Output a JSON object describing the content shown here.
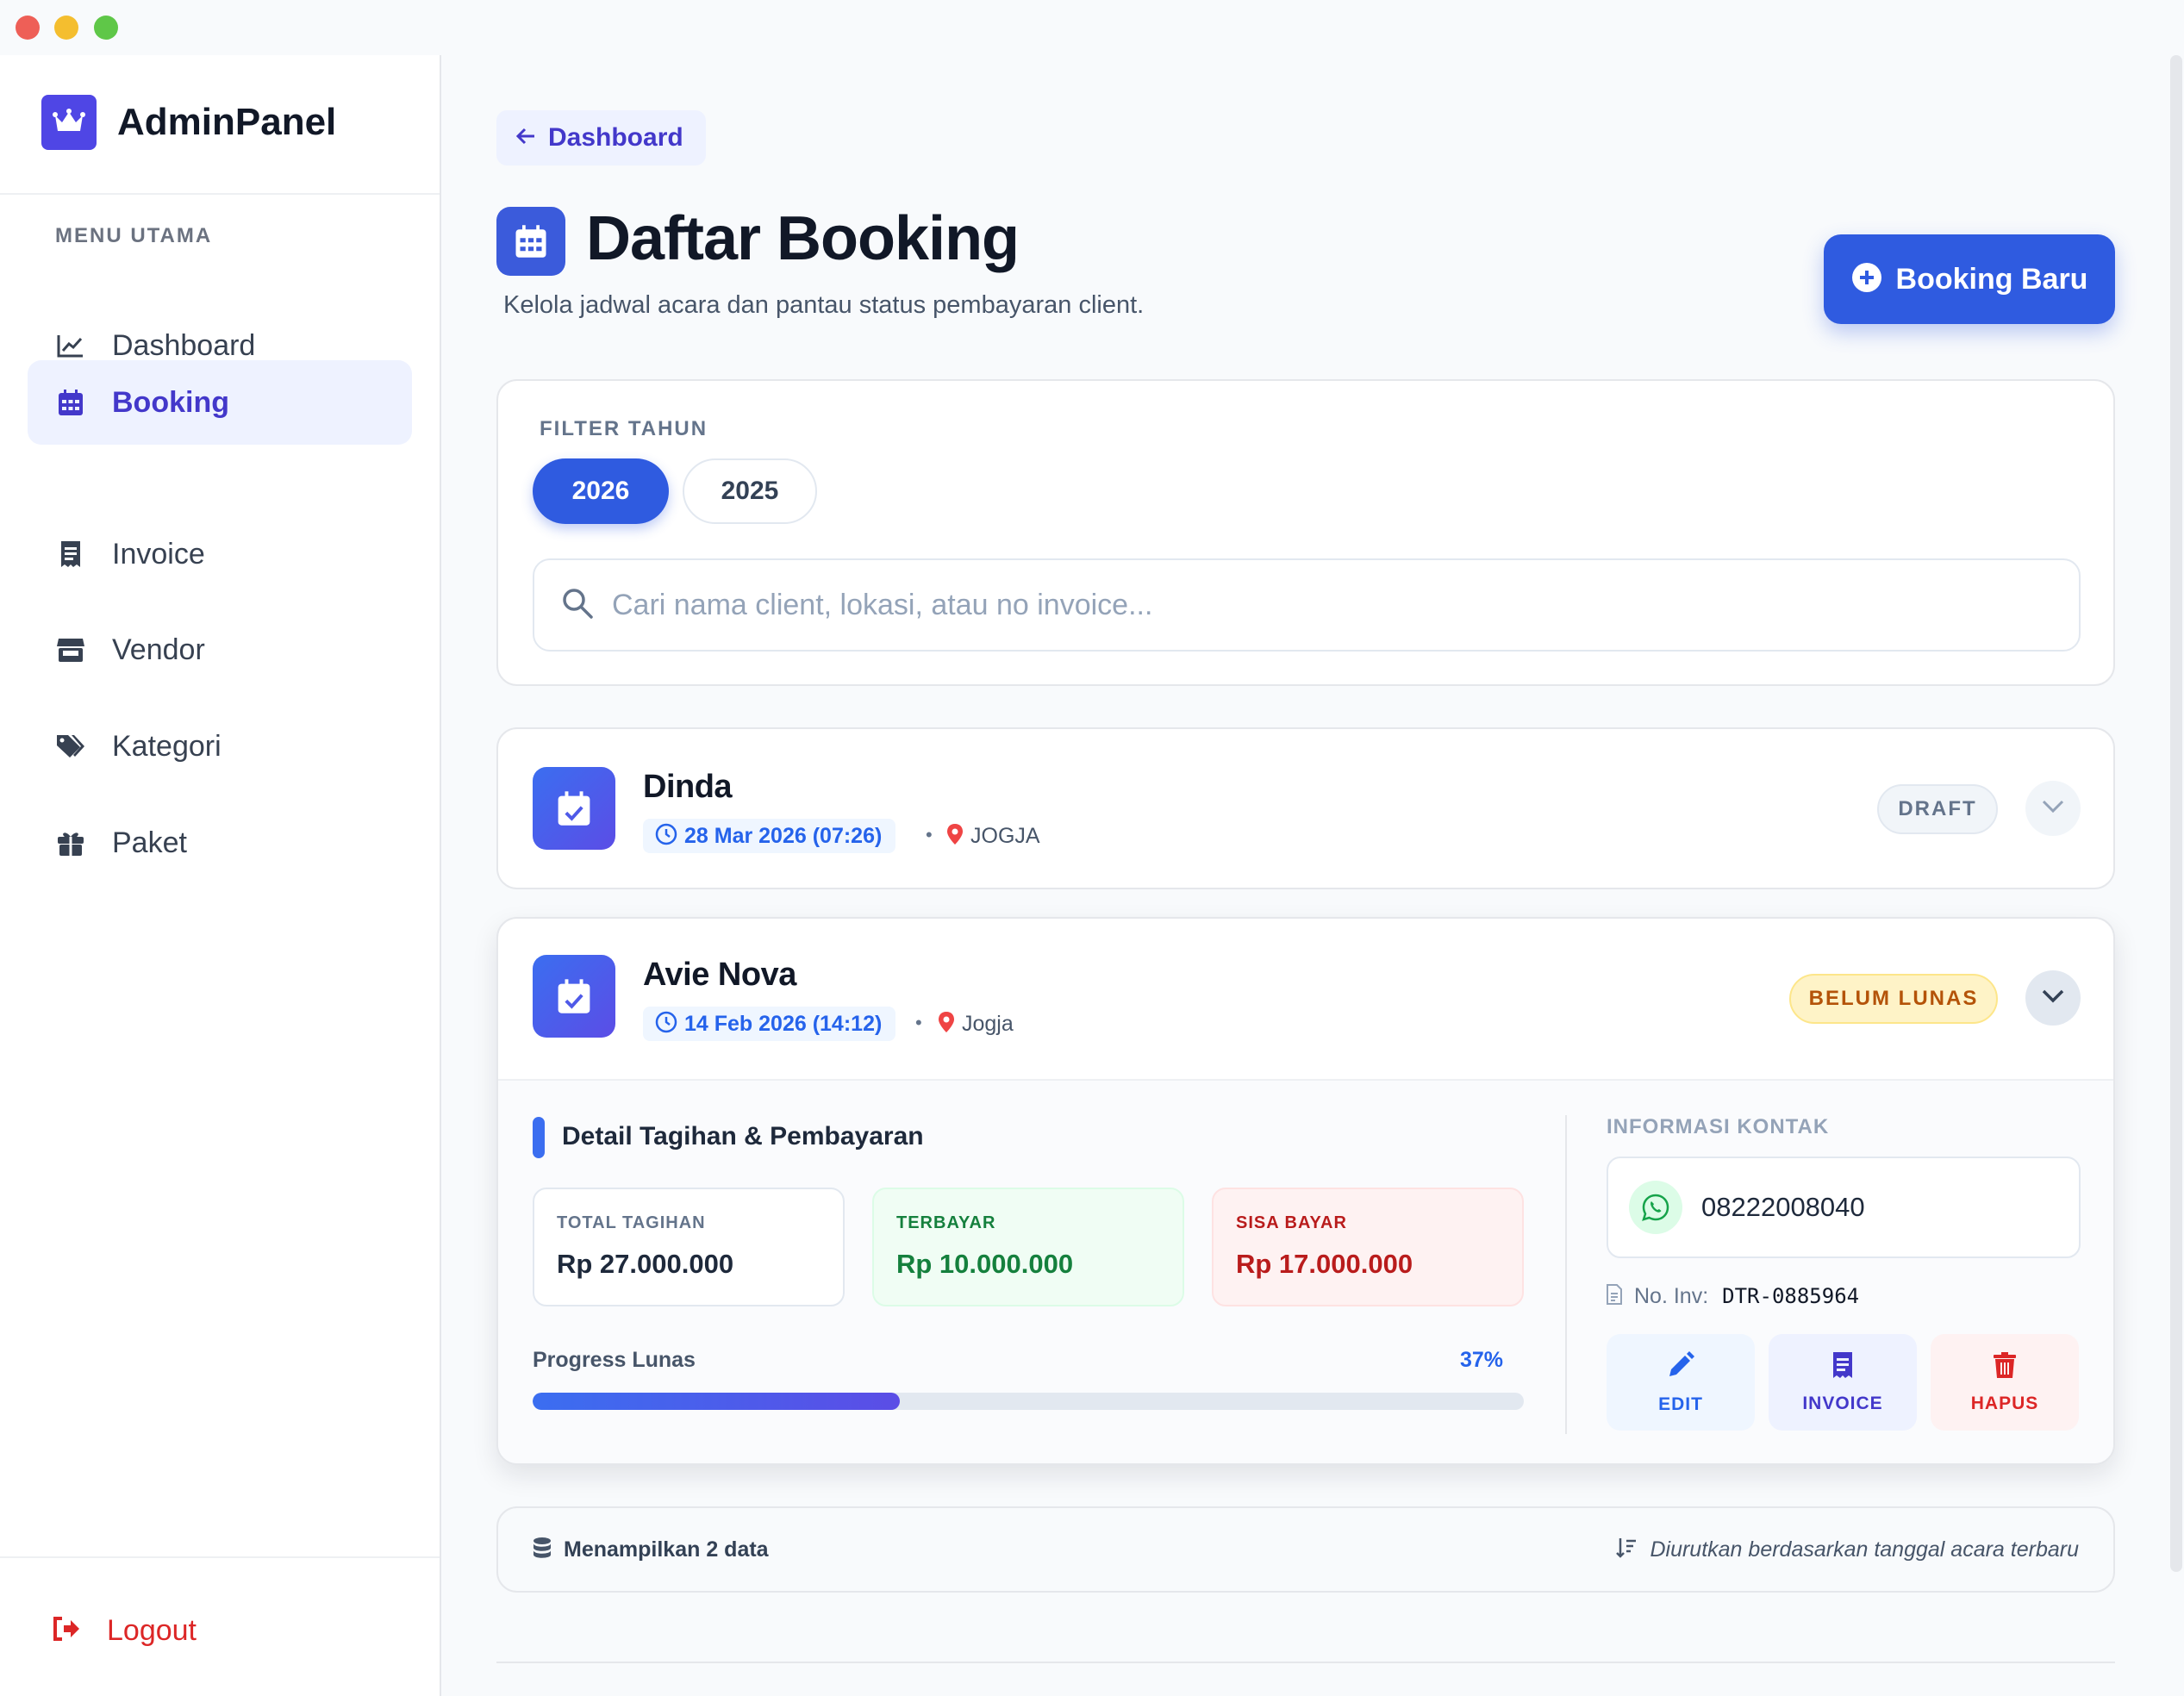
{
  "app": {
    "brand": "AdminPanel"
  },
  "colors": {
    "accent": "#2f5be0",
    "brand": "#4f46e5",
    "danger": "#dc2626",
    "success": "#15803d",
    "warning": "#b45309"
  },
  "sidebar": {
    "heading": "MENU UTAMA",
    "items": [
      {
        "label": "Dashboard",
        "icon": "chart-line-icon",
        "active": false
      },
      {
        "label": "Booking",
        "icon": "calendar-icon",
        "active": true
      },
      {
        "label": "Invoice",
        "icon": "receipt-icon",
        "active": false
      },
      {
        "label": "Vendor",
        "icon": "store-icon",
        "active": false
      },
      {
        "label": "Kategori",
        "icon": "tags-icon",
        "active": false
      },
      {
        "label": "Paket",
        "icon": "gift-icon",
        "active": false
      }
    ],
    "logout": "Logout"
  },
  "header": {
    "back_label": "Dashboard",
    "title": "Daftar Booking",
    "subtitle": "Kelola jadwal acara dan pantau status pembayaran client.",
    "new_button": "Booking Baru"
  },
  "filter": {
    "label": "FILTER TAHUN",
    "years": [
      "2026",
      "2025"
    ],
    "selected": "2026",
    "search_placeholder": "Cari nama client, lokasi, atau no invoice...",
    "search_value": ""
  },
  "bookings": [
    {
      "name": "Dinda",
      "date": "28 Mar 2026 (07:26)",
      "location": "JOGJA",
      "status": "DRAFT",
      "expanded": false
    },
    {
      "name": "Avie Nova",
      "date": "14 Feb 2026 (14:12)",
      "location": "Jogja",
      "status": "BELUM LUNAS",
      "expanded": true,
      "detail": {
        "section_title": "Detail Tagihan & Pembayaran",
        "total_label": "TOTAL TAGIHAN",
        "total_value": "Rp 27.000.000",
        "paid_label": "TERBAYAR",
        "paid_value": "Rp 10.000.000",
        "rest_label": "SISA BAYAR",
        "rest_value": "Rp 17.000.000",
        "progress_label": "Progress Lunas",
        "progress_text": "37%",
        "progress_fraction": 0.37,
        "contact_label": "INFORMASI KONTAK",
        "phone": "08222008040",
        "invoice_label": "No. Inv:",
        "invoice_number": "DTR-0885964",
        "actions": {
          "edit": "EDIT",
          "invoice": "INVOICE",
          "delete": "HAPUS"
        }
      }
    }
  ],
  "footer": {
    "count_text": "Menampilkan 2 data",
    "sort_text": "Diurutkan berdasarkan tanggal acara terbaru"
  }
}
